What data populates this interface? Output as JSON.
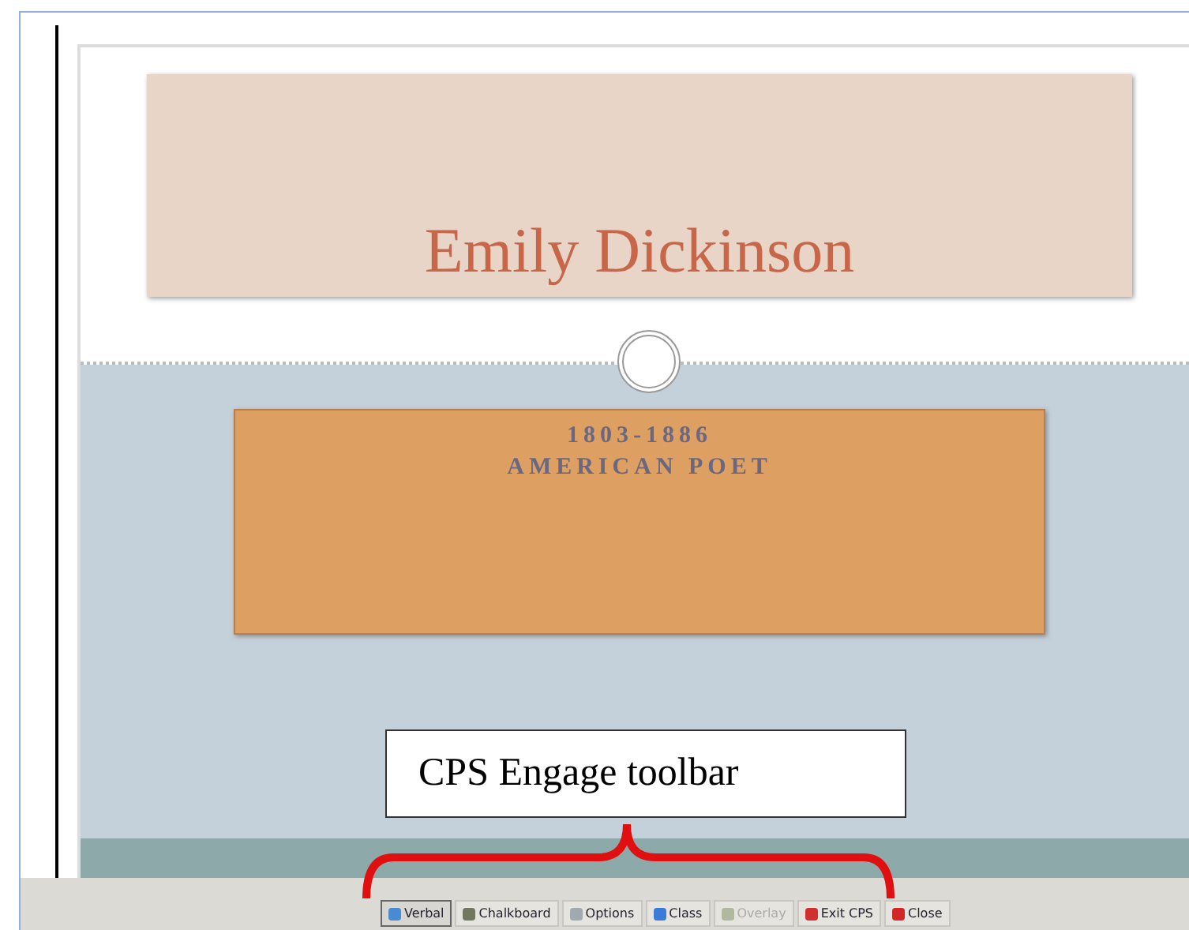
{
  "slide": {
    "title": "Emily Dickinson",
    "subtitle_lines": [
      "1803-1886",
      "AMERICAN POET"
    ]
  },
  "callout": {
    "text": "CPS Engage toolbar"
  },
  "toolbar": {
    "buttons": [
      {
        "label": "Verbal",
        "kind": "verbal",
        "selected": true,
        "disabled": false
      },
      {
        "label": "Chalkboard",
        "kind": "chalkboard",
        "selected": false,
        "disabled": false
      },
      {
        "label": "Options",
        "kind": "options",
        "selected": false,
        "disabled": false
      },
      {
        "label": "Class",
        "kind": "class",
        "selected": false,
        "disabled": false
      },
      {
        "label": "Overlay",
        "kind": "overlay",
        "selected": false,
        "disabled": true
      },
      {
        "label": "Exit CPS",
        "kind": "exit",
        "selected": false,
        "disabled": false
      },
      {
        "label": "Close",
        "kind": "close",
        "selected": false,
        "disabled": false
      }
    ]
  }
}
